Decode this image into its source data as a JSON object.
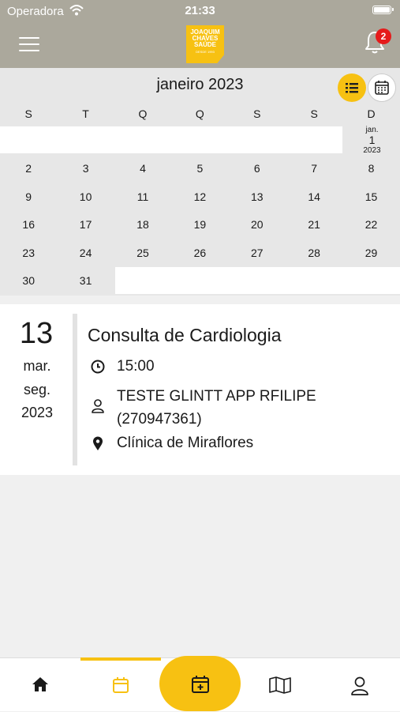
{
  "status_bar": {
    "carrier": "Operadora",
    "time": "21:33"
  },
  "header": {
    "logo": {
      "line1": "JOAQUIM",
      "line2": "CHAVES",
      "line3": "SAÚDE",
      "tag": "DESDE 1993"
    },
    "notification_count": "2"
  },
  "calendar": {
    "month_label": "janeiro  2023",
    "weekdays": [
      "S",
      "T",
      "Q",
      "Q",
      "S",
      "S",
      "D"
    ],
    "today": {
      "month": "jan.",
      "day": "1",
      "year": "2023"
    },
    "weeks": [
      [
        "2",
        "3",
        "4",
        "5",
        "6",
        "7",
        "8"
      ],
      [
        "9",
        "10",
        "11",
        "12",
        "13",
        "14",
        "15"
      ],
      [
        "16",
        "17",
        "18",
        "19",
        "20",
        "21",
        "22"
      ],
      [
        "23",
        "24",
        "25",
        "26",
        "27",
        "28",
        "29"
      ],
      [
        "30",
        "31"
      ]
    ]
  },
  "appointment": {
    "day": "13",
    "month": "mar.",
    "weekday": "seg.",
    "year": "2023",
    "title": "Consulta de Cardiologia",
    "time": "15:00",
    "patient": "TESTE GLINTT APP RFILIPE (270947361)",
    "location": "Clínica de Miraflores"
  },
  "tabs": [
    "home",
    "calendar",
    "add-appointment",
    "map",
    "profile"
  ],
  "colors": {
    "accent": "#f7c112",
    "header": "#aba89c",
    "badge": "#e51b1b"
  }
}
